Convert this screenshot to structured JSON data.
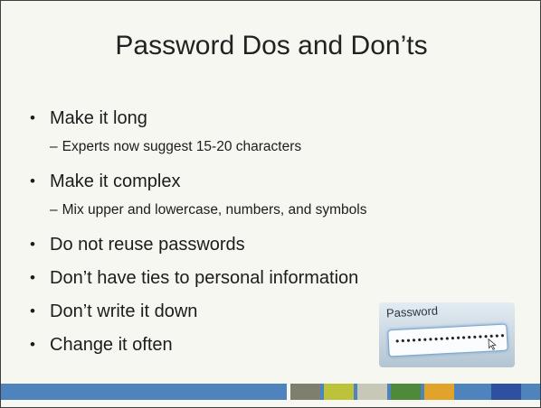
{
  "slide": {
    "title": "Password Dos and Don’ts",
    "bullets": [
      {
        "level": 1,
        "text": "Make it long"
      },
      {
        "level": 2,
        "text": "Experts now suggest 15-20 characters"
      },
      {
        "level": 1,
        "text": "Make it complex"
      },
      {
        "level": 2,
        "text": "Mix upper and lowercase, numbers, and symbols"
      },
      {
        "level": 1,
        "text": "Do not reuse passwords"
      },
      {
        "level": 1,
        "text": "Don’t have ties to personal information"
      },
      {
        "level": 1,
        "text": "Don’t write it down"
      },
      {
        "level": 1,
        "text": "Change it often"
      }
    ],
    "bullet_glyph": "•",
    "dash_glyph": "–",
    "image": {
      "label": "Password",
      "masked_value": "••••••••••••••••••••",
      "icon": "mouse-cursor-icon"
    },
    "colors": {
      "background": "#f6f7f1",
      "bar": "#4f83bd",
      "swatches": [
        "#7f7f6f",
        "#bcc33a",
        "#c8c8b8",
        "#4f8a3b",
        "#e2a32a",
        "#4f83bd",
        "#2f4fa0"
      ]
    }
  }
}
